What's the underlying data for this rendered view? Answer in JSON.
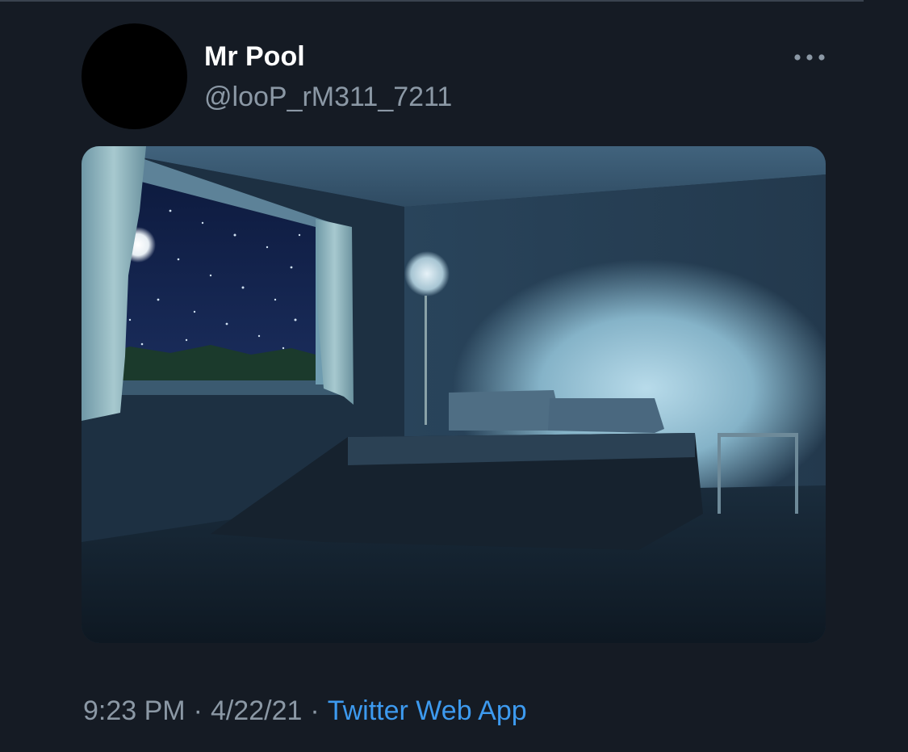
{
  "tweet": {
    "author": {
      "display_name": "Mr Pool",
      "handle": "@looP_rM311_7211",
      "avatar_color": "#000000"
    },
    "more_icon": "more-horizontal-icon",
    "media": {
      "subject": "bedroom-at-night-photo"
    },
    "meta": {
      "time": "9:23 PM",
      "separator": "·",
      "date": "4/22/21",
      "source": "Twitter Web App"
    }
  },
  "colors": {
    "background": "#151b24",
    "primary_text": "#ffffff",
    "secondary_text": "#8b98a5",
    "link": "#3d9aef"
  }
}
